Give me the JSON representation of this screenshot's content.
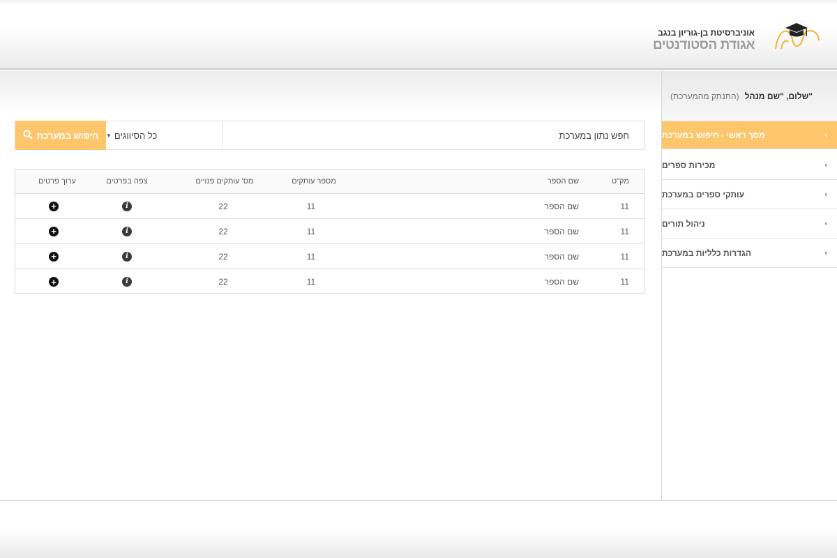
{
  "header": {
    "logo_line1": "אוניברסיטת בן-גוריון בנגב",
    "logo_line2": "אגודת הסטודנטים",
    "logo_colors": {
      "cap": "#222222",
      "swoosh": "#f3b233"
    }
  },
  "sidebar": {
    "greeting": "שלום, \"שם מנהל\"",
    "logout": "(התנתק מהמערכת)",
    "items": [
      {
        "label": "מסך ראשי - חיפוש במערכת",
        "active": true
      },
      {
        "label": "מכירות ספרים",
        "active": false
      },
      {
        "label": "עותקי ספרים במערכת",
        "active": false
      },
      {
        "label": "ניהול תורים",
        "active": false
      },
      {
        "label": "הגדרות כלליות במערכת",
        "active": false
      }
    ]
  },
  "search": {
    "placeholder": "חפש נתון במערכת",
    "category": "כל הסיווגים",
    "button_label": "חיפוש במערכת"
  },
  "table": {
    "headers": {
      "sku": "מק\"ט",
      "name": "שם הספר",
      "copies": "מספר עותקים",
      "free": "מס' עותקים פנויים",
      "view": "צפה בפרטים",
      "edit": "ערוך פרטים"
    },
    "rows": [
      {
        "sku": "11",
        "name": "שם הספר",
        "copies": "11",
        "free": "22"
      },
      {
        "sku": "11",
        "name": "שם הספר",
        "copies": "11",
        "free": "22"
      },
      {
        "sku": "11",
        "name": "שם הספר",
        "copies": "11",
        "free": "22"
      },
      {
        "sku": "11",
        "name": "שם הספר",
        "copies": "11",
        "free": "22"
      }
    ]
  },
  "theme": {
    "accent": "#fdc66a"
  }
}
